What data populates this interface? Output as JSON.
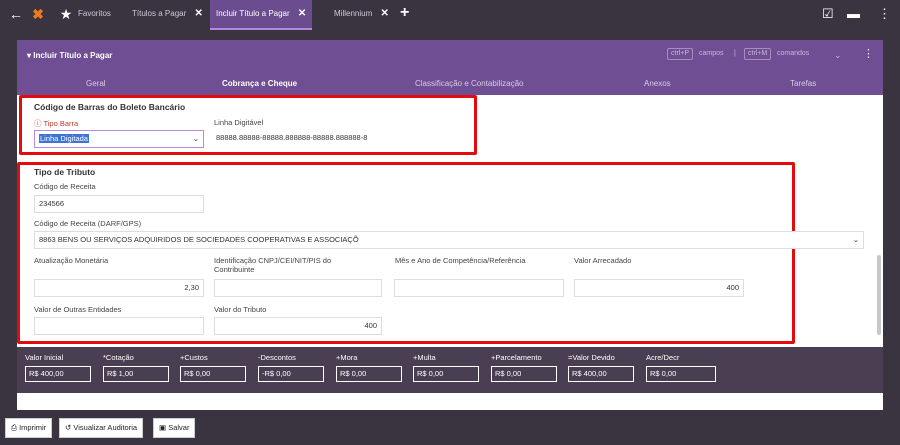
{
  "topbar": {
    "tabs": [
      {
        "label": "Favoritos"
      },
      {
        "label": "Títulos a Pagar"
      },
      {
        "label": "Incluir Título a Pagar"
      },
      {
        "label": "Millennium"
      }
    ]
  },
  "window": {
    "title": "Incluir Título a Pagar",
    "shortcut1_key": "ctrl+P",
    "shortcut1_label": "campos",
    "separator": "|",
    "shortcut2_key": "ctrl+M",
    "shortcut2_label": "comandos",
    "tabs": [
      {
        "label": "Geral"
      },
      {
        "label": "Cobrança e Cheque"
      },
      {
        "label": "Classificação e Contabilização"
      },
      {
        "label": "Anexos"
      },
      {
        "label": "Tarefas"
      }
    ]
  },
  "boleto": {
    "section_title": "Código de Barras do Boleto Bancário",
    "tipo_barra_label": "Tipo Barra",
    "tipo_barra_value": "Linha Digitada",
    "linha_digitavel_label": "Linha Digitável",
    "linha_digitavel_value": "88888.88888-88888.888888-88888.888888-8"
  },
  "tributo": {
    "section_title": "Tipo de Tributo",
    "codigo_receita_label": "Código de Receita",
    "codigo_receita_value": "234566",
    "darf_label": "Código de Receita (DARF/GPS)",
    "darf_value": "8863 BENS OU SERVIÇOS ADQUIRIDOS DE SOCIEDADES COOPERATIVAS E ASSOCIAÇÕ",
    "atualizacao_label": "Atualização Monetária",
    "atualizacao_value": "2,30",
    "identificacao_label_1": "Identificação CNPJ/CEI/NIT/PIS do",
    "identificacao_label_2": "Contribuinte",
    "identificacao_value": "",
    "mes_ano_label": "Mês e Ano de Competência/Referência",
    "mes_ano_value": "",
    "valor_arrecadado_label": "Valor Arrecadado",
    "valor_arrecadado_value": "400",
    "outras_entidades_label": "Valor de Outras Entidades",
    "outras_entidades_value": "",
    "valor_tributo_label": "Valor do Tributo",
    "valor_tributo_value": "400"
  },
  "totals": [
    {
      "label": "Valor Inicial",
      "value": "R$ 400,00"
    },
    {
      "label": "*Cotação",
      "value": "R$ 1,00"
    },
    {
      "label": "+Custos",
      "value": "R$ 0,00"
    },
    {
      "label": "-Descontos",
      "value": "-R$ 0,00"
    },
    {
      "label": "+Mora",
      "value": "R$ 0,00"
    },
    {
      "label": "+Multa",
      "value": "R$ 0,00"
    },
    {
      "label": "+Parcelamento",
      "value": "R$ 0,00"
    },
    {
      "label": "=Valor Devido",
      "value": "R$ 400,00"
    },
    {
      "label": "Acre/Decr",
      "value": "R$ 0,00"
    }
  ],
  "footer": {
    "imprimir": "Imprimir",
    "auditoria": "Visualizar Auditoria",
    "salvar": "Salvar"
  },
  "colors": {
    "accent": "#6f4e94",
    "highlight_border": "#e30c0c",
    "dark_bg": "#3a3440"
  }
}
